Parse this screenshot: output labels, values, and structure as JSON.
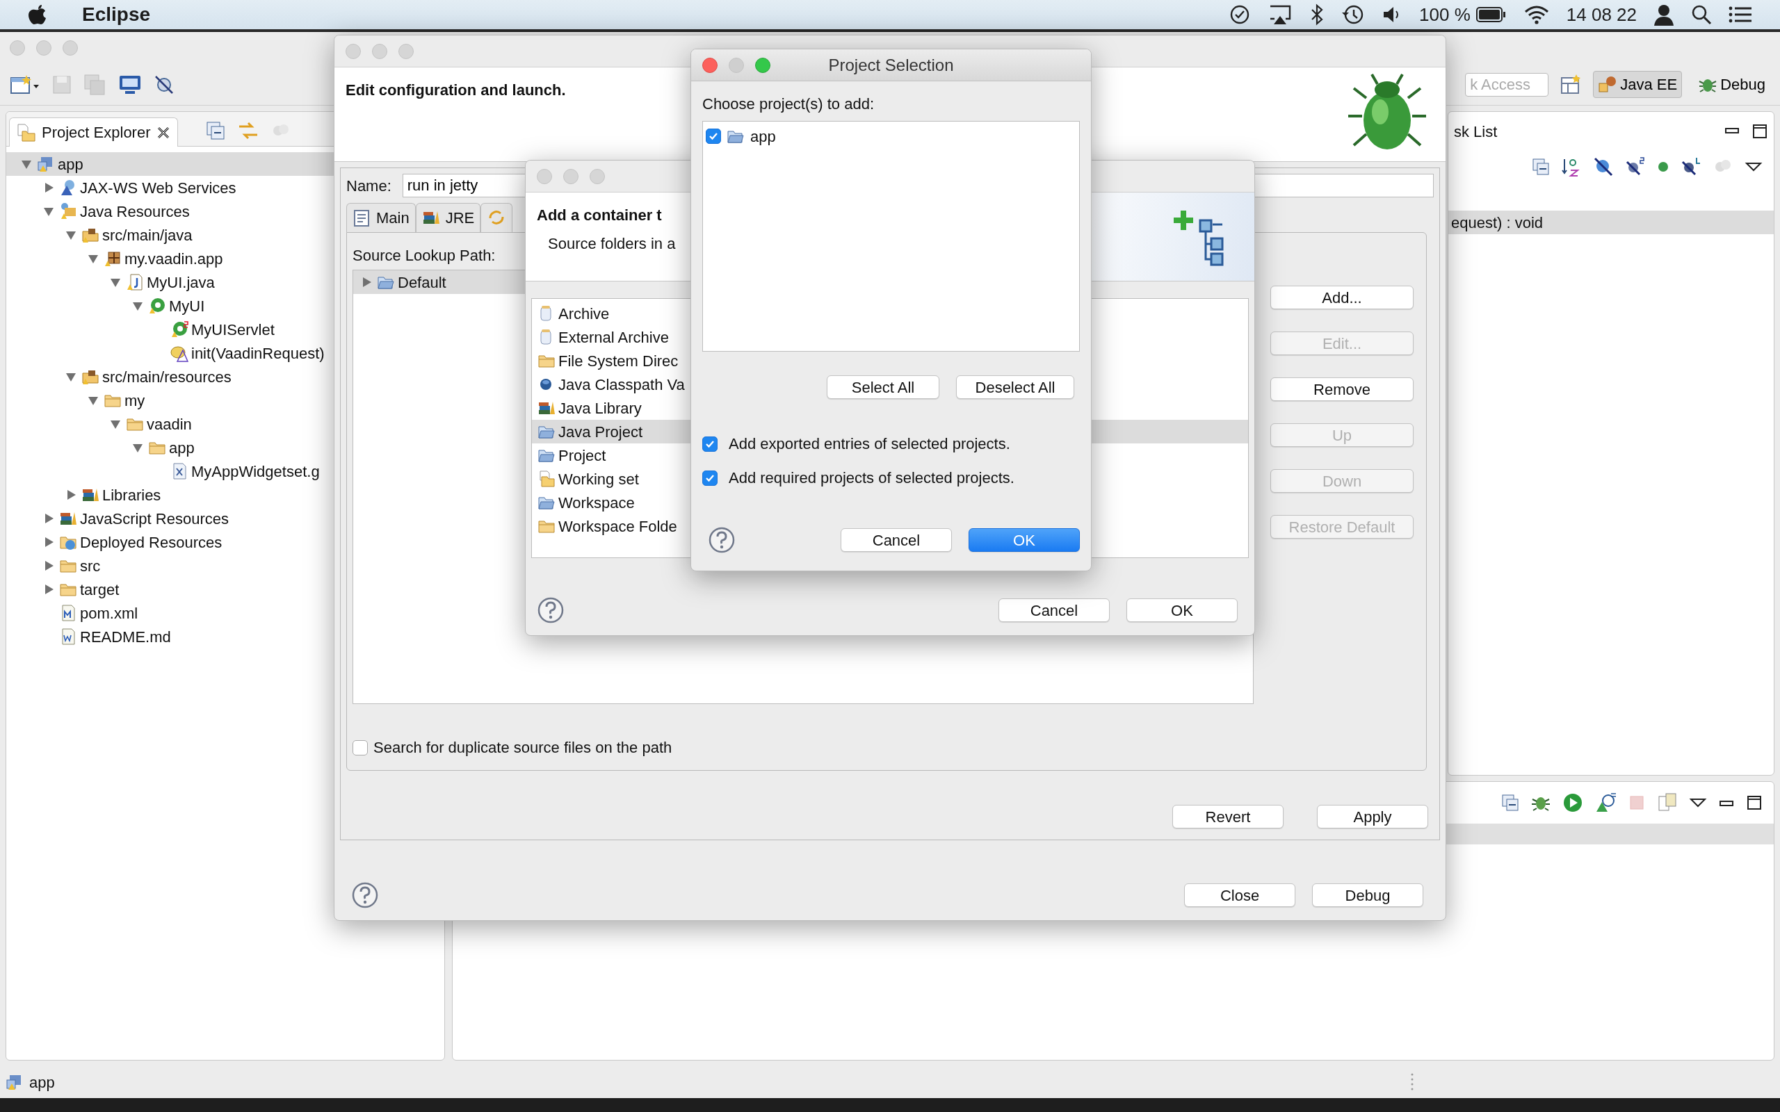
{
  "menu_bar": {
    "app_name": "Eclipse",
    "battery": "100 %",
    "clock": "14 08 22"
  },
  "toolbar": {
    "quick_access_placeholder": "k Access",
    "perspectives": [
      {
        "label": "Java EE",
        "kind": "javaee",
        "selected": true
      },
      {
        "label": "Debug",
        "kind": "debug",
        "selected": false
      }
    ]
  },
  "project_explorer": {
    "title": "Project Explorer",
    "tree": [
      {
        "label": "app",
        "kind": "project",
        "expanded": true,
        "selected": true,
        "children": [
          {
            "label": "JAX-WS Web Services",
            "kind": "webservice",
            "expanded": false,
            "selected": false
          },
          {
            "label": "Java Resources",
            "kind": "javares",
            "expanded": true,
            "selected": false,
            "children": [
              {
                "label": "src/main/java",
                "kind": "srcfolder",
                "expanded": true,
                "selected": false,
                "children": [
                  {
                    "label": "my.vaadin.app",
                    "kind": "package",
                    "expanded": true,
                    "selected": false,
                    "children": [
                      {
                        "label": "MyUI.java",
                        "kind": "javafile",
                        "expanded": true,
                        "selected": false,
                        "children": [
                          {
                            "label": "MyUI",
                            "kind": "class",
                            "expanded": true,
                            "selected": false,
                            "children": [
                              {
                                "label": "MyUIServlet",
                                "kind": "servlet",
                                "selected": false
                              },
                              {
                                "label": "init(VaadinRequest)",
                                "kind": "method",
                                "selected": false
                              }
                            ]
                          }
                        ]
                      }
                    ]
                  }
                ]
              },
              {
                "label": "src/main/resources",
                "kind": "srcfolder",
                "expanded": true,
                "selected": false,
                "children": [
                  {
                    "label": "my",
                    "kind": "folder",
                    "expanded": true,
                    "selected": false,
                    "children": [
                      {
                        "label": "vaadin",
                        "kind": "folder",
                        "expanded": true,
                        "selected": false,
                        "children": [
                          {
                            "label": "app",
                            "kind": "folder",
                            "expanded": true,
                            "selected": false,
                            "children": [
                              {
                                "label": "MyAppWidgetset.g",
                                "kind": "xmlfile",
                                "selected": false
                              }
                            ]
                          }
                        ]
                      }
                    ]
                  }
                ]
              },
              {
                "label": "Libraries",
                "kind": "library",
                "expanded": false,
                "selected": false
              }
            ]
          },
          {
            "label": "JavaScript Resources",
            "kind": "library",
            "expanded": false,
            "selected": false
          },
          {
            "label": "Deployed Resources",
            "kind": "deployed",
            "expanded": false,
            "selected": false
          },
          {
            "label": "src",
            "kind": "folder",
            "expanded": false,
            "selected": false
          },
          {
            "label": "target",
            "kind": "folder",
            "expanded": false,
            "selected": false
          },
          {
            "label": "pom.xml",
            "kind": "mavenfile",
            "selected": false
          },
          {
            "label": "README.md",
            "kind": "textfile",
            "selected": false
          }
        ]
      }
    ]
  },
  "task_list": {
    "title": "sk List",
    "rows": [
      {
        "text": "equest) : void",
        "selected": true
      }
    ]
  },
  "status_bar": {
    "text": "app"
  },
  "edit_configuration": {
    "header": "Edit configuration and launch.",
    "name_label": "Name:",
    "name_value": "run in jetty",
    "tabs": [
      {
        "kind": "main",
        "label": "Main",
        "selected": false
      },
      {
        "kind": "jre",
        "label": "JRE",
        "selected": false
      },
      {
        "kind": "source",
        "selected": false
      }
    ],
    "lookup_label": "Source Lookup Path:",
    "lookup_tree": [
      {
        "label": "Default",
        "expanded": false,
        "selected": true
      }
    ],
    "side_buttons": [
      {
        "label": "Add...",
        "disabled": false
      },
      {
        "label": "Edit...",
        "disabled": true
      },
      {
        "label": "Remove",
        "disabled": false
      },
      {
        "label": "Up",
        "disabled": true
      },
      {
        "label": "Down",
        "disabled": true
      },
      {
        "label": "Restore Default",
        "disabled": true
      }
    ],
    "duplicate_check": {
      "label": "Search for duplicate source files on the path",
      "checked": false
    },
    "buttons": [
      "Revert",
      "Apply"
    ],
    "footer_buttons": [
      "Close",
      "Debug"
    ]
  },
  "add_container": {
    "header": "Add a container t",
    "subheader": "Source folders in a",
    "items": [
      {
        "label": "Archive",
        "kind": "jar",
        "selected": false
      },
      {
        "label": "External Archive",
        "kind": "jar",
        "selected": false
      },
      {
        "label": "File System Direc",
        "kind": "folder",
        "selected": false
      },
      {
        "label": "Java Classpath Va",
        "kind": "dot",
        "selected": false
      },
      {
        "label": "Java Library",
        "kind": "library",
        "selected": false
      },
      {
        "label": "Java Project",
        "kind": "openfolder",
        "selected": true
      },
      {
        "label": "Project",
        "kind": "openfolder",
        "selected": false
      },
      {
        "label": "Working set",
        "kind": "workingset",
        "selected": false
      },
      {
        "label": "Workspace",
        "kind": "openfolder",
        "selected": false
      },
      {
        "label": "Workspace Folde",
        "kind": "folder",
        "selected": false
      }
    ],
    "buttons": [
      "Cancel",
      "OK"
    ]
  },
  "project_selection": {
    "title": "Project Selection",
    "prompt": "Choose project(s) to add:",
    "projects": [
      {
        "label": "app",
        "checked": true
      }
    ],
    "select_buttons": [
      "Select All",
      "Deselect All"
    ],
    "options": [
      {
        "label": "Add exported entries of selected projects.",
        "checked": true
      },
      {
        "label": "Add required projects of selected projects.",
        "checked": true
      }
    ],
    "buttons": [
      {
        "label": "Cancel",
        "primary": false
      },
      {
        "label": "OK",
        "primary": true
      }
    ]
  }
}
